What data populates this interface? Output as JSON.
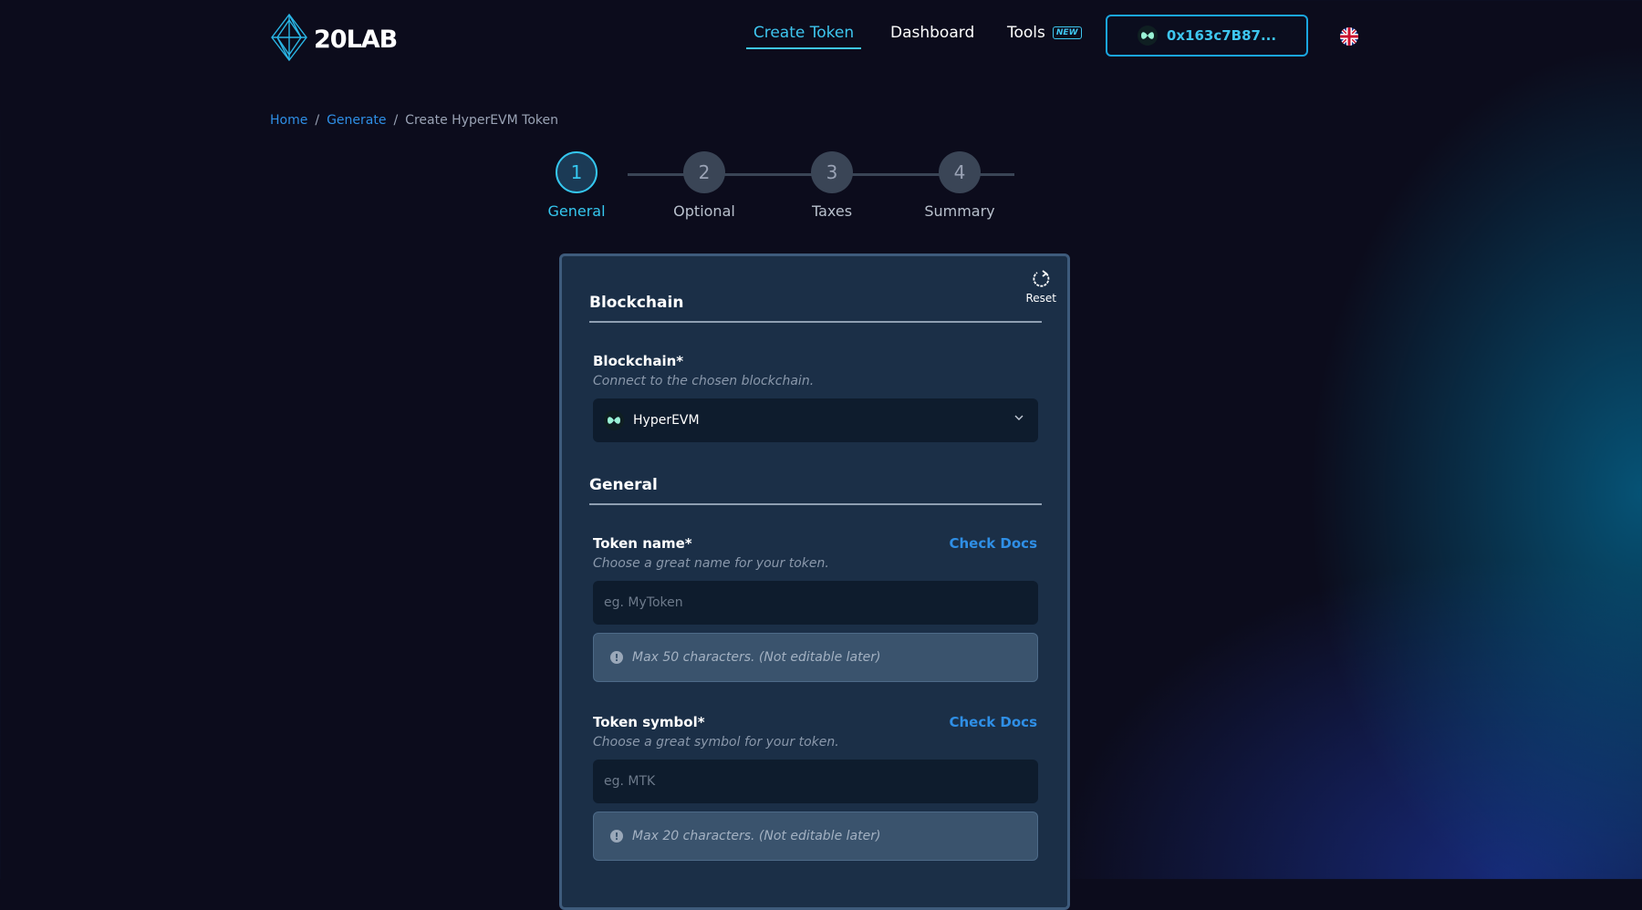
{
  "app": {
    "logo_text": "20LAB"
  },
  "nav": {
    "create_token": "Create Token",
    "dashboard": "Dashboard",
    "tools": "Tools",
    "tools_badge": "NEW",
    "wallet_address": "0x163c7B87..."
  },
  "breadcrumb": {
    "home": "Home",
    "generate": "Generate",
    "current": "Create HyperEVM Token",
    "separator": "/"
  },
  "stepper": {
    "active_step": 1,
    "steps": [
      {
        "number": "1",
        "label": "General"
      },
      {
        "number": "2",
        "label": "Optional"
      },
      {
        "number": "3",
        "label": "Taxes"
      },
      {
        "number": "4",
        "label": "Summary"
      }
    ]
  },
  "form": {
    "reset_label": "Reset",
    "blockchain_section": "Blockchain",
    "blockchain_label": "Blockchain*",
    "blockchain_help": "Connect to the chosen blockchain.",
    "blockchain_value": "HyperEVM",
    "general_section": "General",
    "token_name_label": "Token name*",
    "token_name_help": "Choose a great name for your token.",
    "token_name_placeholder": "eg. MyToken",
    "token_name_value": "",
    "token_name_notice": "Max 50 characters. (Not editable later)",
    "token_symbol_label": "Token symbol*",
    "token_symbol_help": "Choose a great symbol for your token.",
    "token_symbol_placeholder": "eg. MTK",
    "token_symbol_value": "",
    "token_symbol_notice": "Max 20 characters. (Not editable later)",
    "check_docs": "Check Docs"
  },
  "colors": {
    "accent": "#35c7ef",
    "link": "#2f8fe6",
    "background": "#0c0c1c",
    "card": "#1b2f47"
  }
}
